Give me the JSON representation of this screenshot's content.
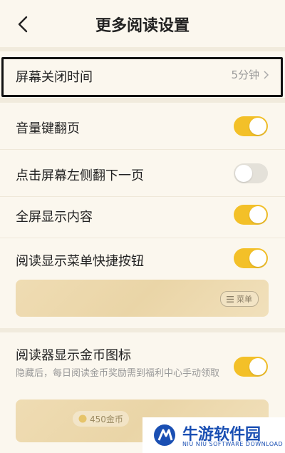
{
  "header": {
    "title": "更多阅读设置"
  },
  "settings": {
    "screen_off": {
      "label": "屏幕关闭时间",
      "value": "5分钟"
    },
    "volume_key": {
      "label": "音量键翻页",
      "on": true
    },
    "tap_left": {
      "label": "点击屏幕左侧翻下一页",
      "on": false
    },
    "fullscreen": {
      "label": "全屏显示内容",
      "on": true
    },
    "menu_shortcut": {
      "label": "阅读显示菜单快捷按钮",
      "on": true,
      "preview_chip": "菜单"
    },
    "coin_icon": {
      "label": "阅读器显示金币图标",
      "on": true,
      "desc": "隐藏后，每日阅读金币奖励需到福利中心手动领取",
      "preview_chip": "450金币"
    }
  },
  "watermark": {
    "name": "牛游软件园",
    "sub": "NIU NIU SOFTWARE DOWNLOAD"
  },
  "colors": {
    "accent": "#f3c028",
    "background": "#fbf7ee"
  }
}
